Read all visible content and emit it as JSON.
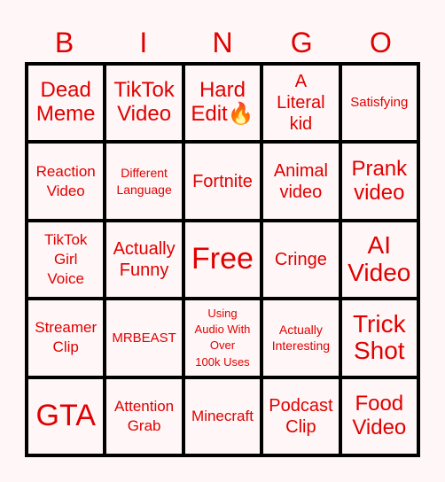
{
  "header": {
    "letters": [
      "B",
      "I",
      "N",
      "G",
      "O"
    ]
  },
  "colors": {
    "accent": "#e00000",
    "background": "#fff7f7",
    "grid": "#000000"
  },
  "board": {
    "rows": [
      [
        "Dead\nMeme",
        "TikTok\nVideo",
        "Hard\nEdit🔥",
        "A\nLiteral\nkid",
        "Satisfying"
      ],
      [
        "Reaction\nVideo",
        "Different\nLanguage",
        "Fortnite",
        "Animal\nvideo",
        "Prank\nvideo"
      ],
      [
        "TikTok\nGirl\nVoice",
        "Actually\nFunny",
        "Free",
        "Cringe",
        "AI\nVideo"
      ],
      [
        "Streamer\nClip",
        "MRBEAST",
        "Using\nAudio With\nOver\n100k Uses",
        "Actually\nInteresting",
        "Trick\nShot"
      ],
      [
        "GTA",
        "Attention\nGrab",
        "Minecraft",
        "Podcast\nClip",
        "Food\nVideo"
      ]
    ],
    "free_space": "Free"
  }
}
